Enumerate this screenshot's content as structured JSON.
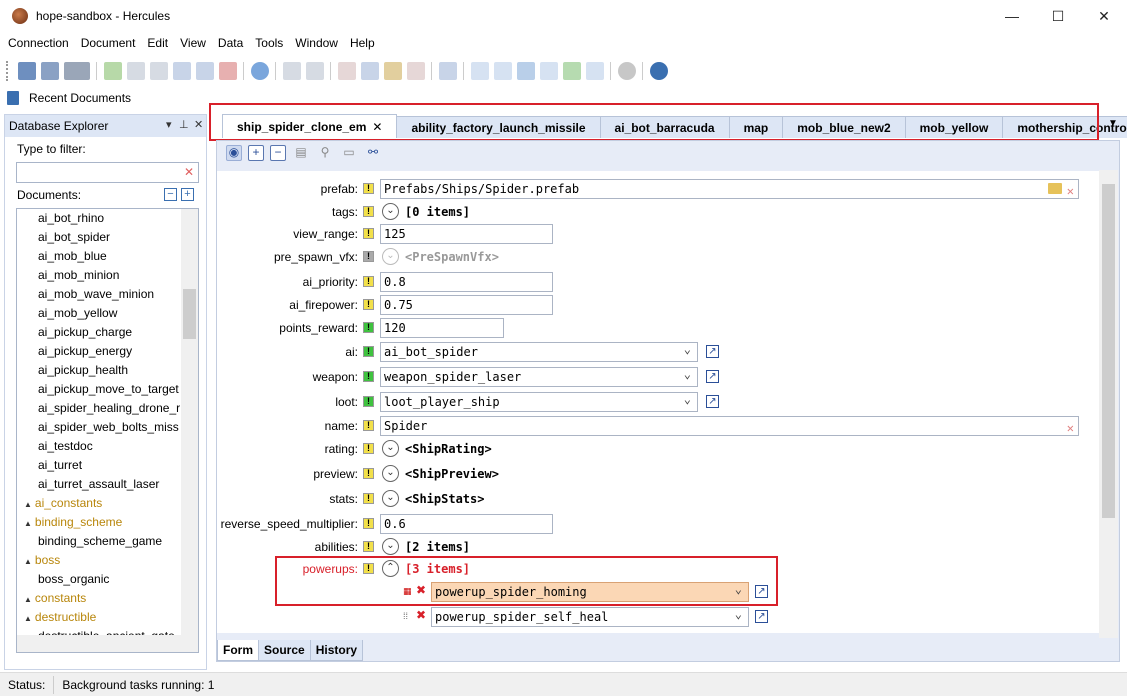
{
  "window": {
    "title": "hope-sandbox - Hercules",
    "min": "—",
    "max": "☐",
    "close": "✕"
  },
  "menu": [
    "Connection",
    "Document",
    "Edit",
    "View",
    "Data",
    "Tools",
    "Window",
    "Help"
  ],
  "recent_label": "Recent Documents",
  "explorer": {
    "title": "Database Explorer",
    "filter_label": "Type to filter:",
    "documents_label": "Documents:",
    "items": [
      {
        "label": "ai_bot_rhino",
        "folder": false
      },
      {
        "label": "ai_bot_spider",
        "folder": false
      },
      {
        "label": "ai_mob_blue",
        "folder": false
      },
      {
        "label": "ai_mob_minion",
        "folder": false
      },
      {
        "label": "ai_mob_wave_minion",
        "folder": false
      },
      {
        "label": "ai_mob_yellow",
        "folder": false
      },
      {
        "label": "ai_pickup_charge",
        "folder": false
      },
      {
        "label": "ai_pickup_energy",
        "folder": false
      },
      {
        "label": "ai_pickup_health",
        "folder": false
      },
      {
        "label": "ai_pickup_move_to_target",
        "folder": false
      },
      {
        "label": "ai_spider_healing_drone_r",
        "folder": false
      },
      {
        "label": "ai_spider_web_bolts_miss",
        "folder": false
      },
      {
        "label": "ai_testdoc",
        "folder": false
      },
      {
        "label": "ai_turret",
        "folder": false
      },
      {
        "label": "ai_turret_assault_laser",
        "folder": false
      },
      {
        "label": "ai_constants",
        "folder": true
      },
      {
        "label": "binding_scheme",
        "folder": true
      },
      {
        "label": "binding_scheme_game",
        "folder": false
      },
      {
        "label": "boss",
        "folder": true
      },
      {
        "label": "boss_organic",
        "folder": false
      },
      {
        "label": "constants",
        "folder": true
      },
      {
        "label": "destructible",
        "folder": true
      },
      {
        "label": "destructible_ancient_gate",
        "folder": false
      }
    ]
  },
  "tabs": [
    {
      "label": "ship_spider_clone_em",
      "active": true,
      "close": "✕"
    },
    {
      "label": "ability_factory_launch_missile"
    },
    {
      "label": "ai_bot_barracuda"
    },
    {
      "label": "map"
    },
    {
      "label": "mob_blue_new2"
    },
    {
      "label": "mob_yellow"
    },
    {
      "label": "mothership_control"
    }
  ],
  "form": {
    "prefab": {
      "label": "prefab:",
      "value": "Prefabs/Ships/Spider.prefab"
    },
    "tags": {
      "label": "tags:",
      "value": "[0 items]"
    },
    "view_range": {
      "label": "view_range:",
      "value": "125"
    },
    "pre_spawn_vfx": {
      "label": "pre_spawn_vfx:",
      "value": "<PreSpawnVfx>"
    },
    "ai_priority": {
      "label": "ai_priority:",
      "value": "0.8"
    },
    "ai_firepower": {
      "label": "ai_firepower:",
      "value": "0.75"
    },
    "points_reward": {
      "label": "points_reward:",
      "value": "120"
    },
    "ai": {
      "label": "ai:",
      "value": "ai_bot_spider"
    },
    "weapon": {
      "label": "weapon:",
      "value": "weapon_spider_laser"
    },
    "loot": {
      "label": "loot:",
      "value": "loot_player_ship"
    },
    "name": {
      "label": "name:",
      "value": "Spider"
    },
    "rating": {
      "label": "rating:",
      "value": "<ShipRating>"
    },
    "preview": {
      "label": "preview:",
      "value": "<ShipPreview>"
    },
    "stats": {
      "label": "stats:",
      "value": "<ShipStats>"
    },
    "reverse_speed_multiplier": {
      "label": "reverse_speed_multiplier:",
      "value": "0.6"
    },
    "abilities": {
      "label": "abilities:",
      "value": "[2 items]"
    },
    "powerups": {
      "label": "powerups:",
      "value": "[3 items]",
      "items": [
        "powerup_spider_homing",
        "powerup_spider_self_heal"
      ]
    }
  },
  "bottom_tabs": [
    "Form",
    "Source",
    "History"
  ],
  "status": {
    "label": "Status:",
    "text": "Background tasks running: 1"
  },
  "colors": {
    "highlight": "#d8202a",
    "field_selected": "#fbd7b5",
    "accent": "#2b4f98"
  }
}
